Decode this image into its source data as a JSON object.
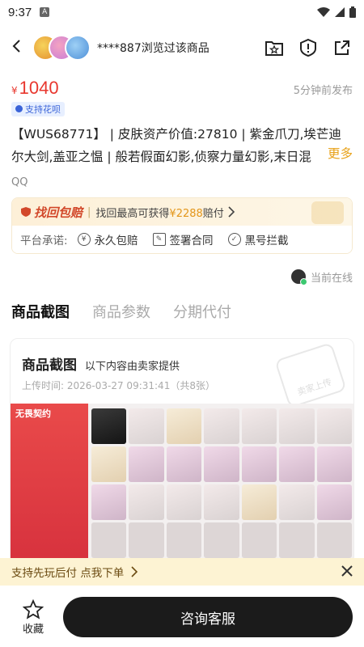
{
  "status_bar": {
    "time": "9:37",
    "notification_icon": "A"
  },
  "header": {
    "viewed_text": "****887浏览过该商品"
  },
  "price": {
    "currency": "¥",
    "amount": "1040",
    "published": "5分钟前发布"
  },
  "badge": {
    "label": "支持花呗"
  },
  "description": {
    "text": "【WUS68771】 | 皮肤资产价值:27810 | 紫金爪刀,埃芒迪尔大剑,盖亚之愠 | 般若假面幻影,侦察力量幻影,末日混",
    "more": "更多"
  },
  "platform": "QQ",
  "guarantee": {
    "logo": "找回包赔",
    "text_prefix": "找回最高可获得",
    "amount": "¥2288",
    "text_suffix": "赔付",
    "promise_label": "平台承诺:",
    "promises": [
      "永久包赔",
      "签署合同",
      "黑号拦截"
    ]
  },
  "seller": {
    "status": "当前在线"
  },
  "tabs": [
    "商品截图",
    "商品参数",
    "分期代付"
  ],
  "screenshots": {
    "title": "商品截图",
    "subtitle": "以下内容由卖家提供",
    "upload_label": "上传时间:",
    "upload_value": "2026-03-27 09:31:41（共8张）",
    "stamp": "卖家上传",
    "brand": "无畏契约"
  },
  "banner": {
    "text": "支持先玩后付  点我下单"
  },
  "bottom": {
    "favorite": "收藏",
    "consult": "咨询客服"
  },
  "colors": {
    "price": "#e8372e",
    "accent_yellow": "#f6dc3c",
    "banner_bg": "#fdf3d3",
    "primary_button": "#1b1b1b"
  }
}
